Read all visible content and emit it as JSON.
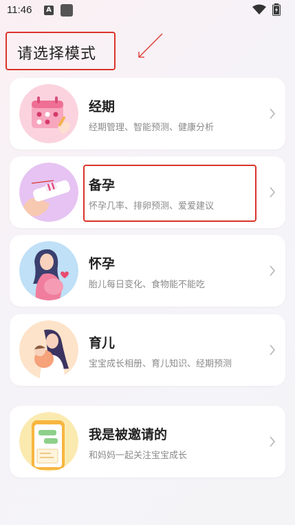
{
  "status_bar": {
    "time": "11:46",
    "notification_letter": "A"
  },
  "header": {
    "title": "请选择模式"
  },
  "modes": [
    {
      "name": "经期",
      "desc": "经期管理、智能预测、健康分析",
      "icon": "calendar-icon"
    },
    {
      "name": "备孕",
      "desc": "怀孕几率、排卵预测、爱爱建议",
      "icon": "pregnancy-test-icon"
    },
    {
      "name": "怀孕",
      "desc": "胎儿每日变化、食物能不能吃",
      "icon": "pregnant-woman-icon"
    },
    {
      "name": "育儿",
      "desc": "宝宝成长相册、育儿知识、经期预测",
      "icon": "mother-baby-icon"
    }
  ],
  "invited": {
    "name": "我是被邀请的",
    "desc": "和妈妈一起关注宝宝成长",
    "icon": "phone-chat-icon"
  },
  "colors": {
    "accent_red": "#d9352a",
    "card_bg": "#ffffff",
    "title_text": "#222222",
    "desc_text": "#8a8a8a"
  }
}
